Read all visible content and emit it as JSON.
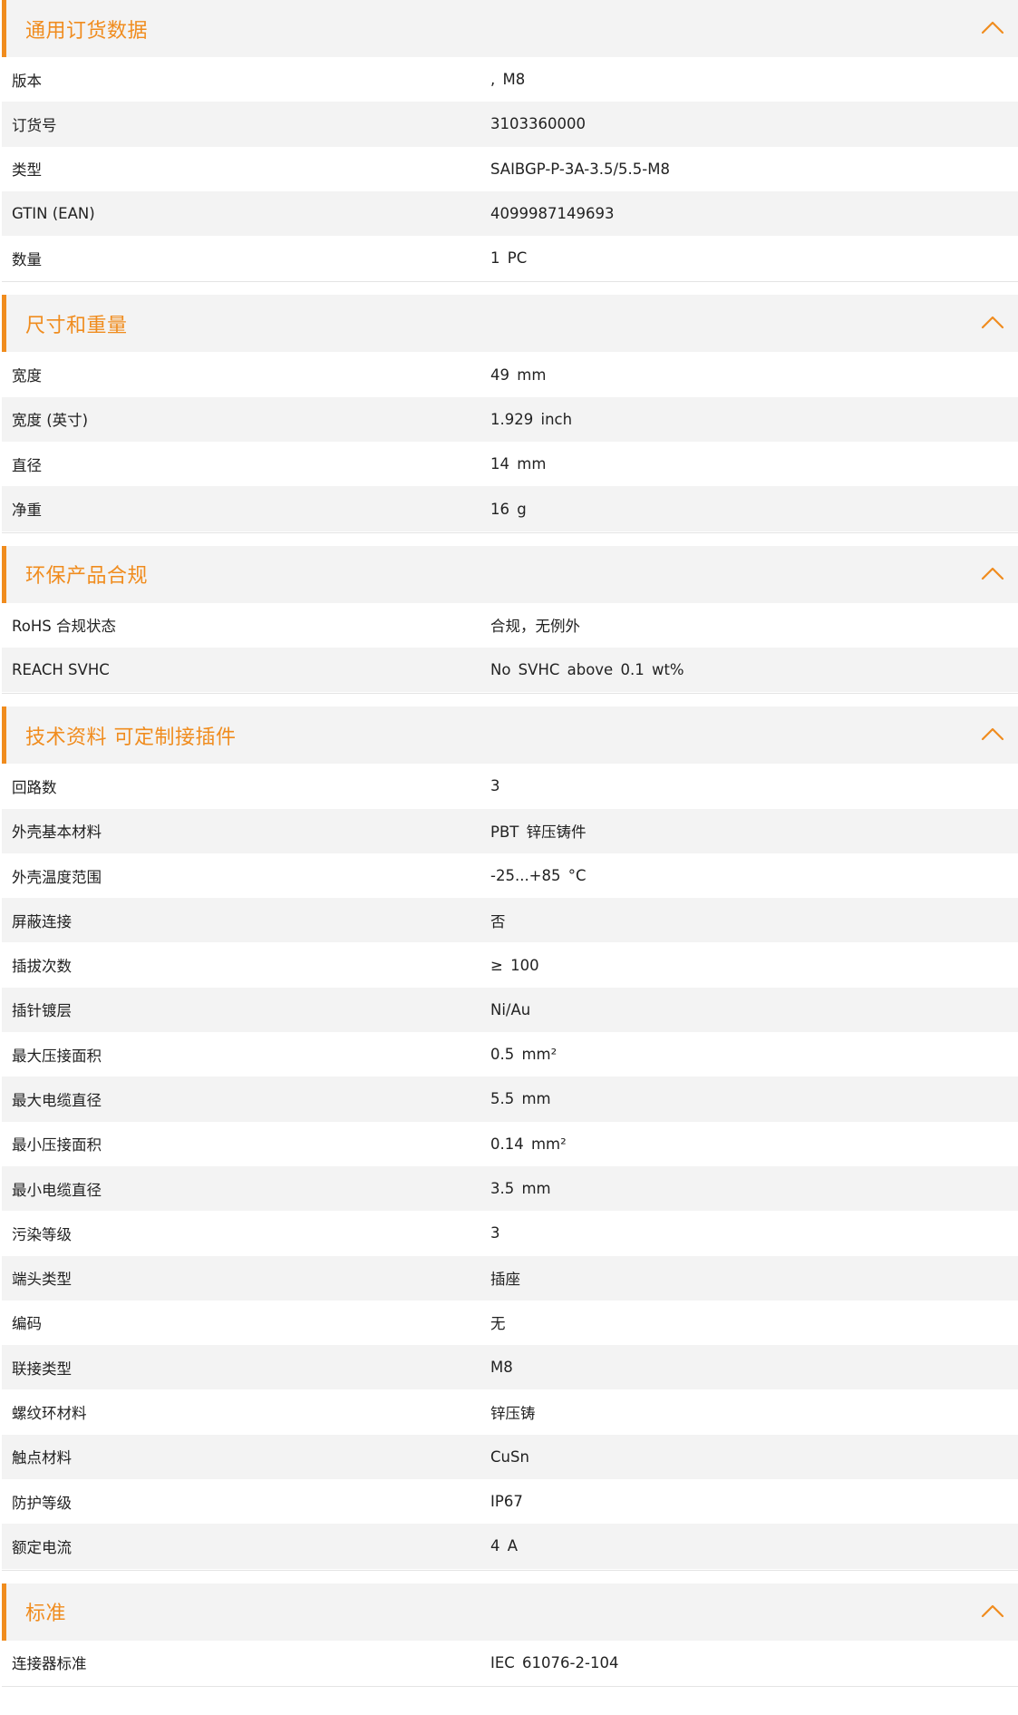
{
  "accent_color": "#f08c1e",
  "sections": [
    {
      "title": "通用订货数据",
      "rows": [
        {
          "label": "版本",
          "value": ", M8"
        },
        {
          "label": "订货号",
          "value": "3103360000"
        },
        {
          "label": "类型",
          "value": "SAIBGP-P-3A-3.5/5.5-M8"
        },
        {
          "label": "GTIN (EAN)",
          "value": "4099987149693"
        },
        {
          "label": "数量",
          "value": "1  PC"
        }
      ]
    },
    {
      "title": "尺寸和重量",
      "rows": [
        {
          "label": "宽度",
          "value": "49  mm"
        },
        {
          "label": "宽度 (英寸)",
          "value": "1.929  inch"
        },
        {
          "label": "直径",
          "value": "14  mm"
        },
        {
          "label": "净重",
          "value": "16  g"
        }
      ]
    },
    {
      "title": "环保产品合规",
      "rows": [
        {
          "label": "RoHS 合规状态",
          "value": "合规，无例外"
        },
        {
          "label": "REACH SVHC",
          "value": "No SVHC above 0.1 wt%"
        }
      ]
    },
    {
      "title": "技术资料 可定制接插件",
      "rows": [
        {
          "label": "回路数",
          "value": "3"
        },
        {
          "label": "外壳基本材料",
          "value": "PBT 锌压铸件"
        },
        {
          "label": "外壳温度范围",
          "value": "-25...+85 °C"
        },
        {
          "label": "屏蔽连接",
          "value": "否"
        },
        {
          "label": "插拔次数",
          "value": "≥ 100"
        },
        {
          "label": "插针镀层",
          "value": "Ni/Au"
        },
        {
          "label": "最大压接面积",
          "value": "0.5  mm²"
        },
        {
          "label": "最大电缆直径",
          "value": "5.5  mm"
        },
        {
          "label": "最小压接面积",
          "value": "0.14  mm²"
        },
        {
          "label": "最小电缆直径",
          "value": "3.5  mm"
        },
        {
          "label": "污染等级",
          "value": "3"
        },
        {
          "label": "端头类型",
          "value": "插座"
        },
        {
          "label": "编码",
          "value": "无"
        },
        {
          "label": "联接类型",
          "value": "M8"
        },
        {
          "label": "螺纹环材料",
          "value": "锌压铸"
        },
        {
          "label": "触点材料",
          "value": "CuSn"
        },
        {
          "label": "防护等级",
          "value": "IP67"
        },
        {
          "label": "额定电流",
          "value": "4  A"
        }
      ]
    },
    {
      "title": "标准",
      "rows": [
        {
          "label": "连接器标准",
          "value": "IEC 61076-2-104"
        }
      ]
    }
  ]
}
